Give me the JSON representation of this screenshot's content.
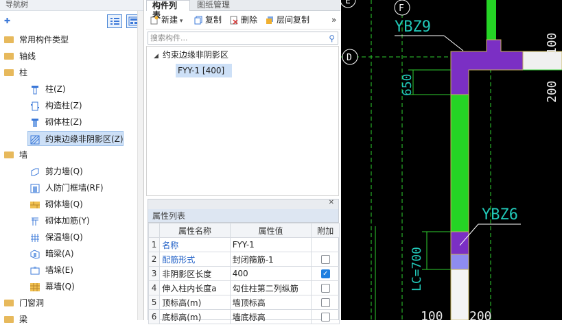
{
  "nav": {
    "title": "导航树",
    "items": [
      {
        "label": "常用构件类型"
      },
      {
        "label": "轴线"
      },
      {
        "label": "柱"
      },
      {
        "label": "柱(Z)"
      },
      {
        "label": "构造柱(Z)"
      },
      {
        "label": "砌体柱(Z)"
      },
      {
        "label": "约束边缘非阴影区(Z)"
      },
      {
        "label": "墙"
      },
      {
        "label": "剪力墙(Q)"
      },
      {
        "label": "人防门框墙(RF)"
      },
      {
        "label": "砌体墙(Q)"
      },
      {
        "label": "砌体加筋(Y)"
      },
      {
        "label": "保温墙(Q)"
      },
      {
        "label": "暗梁(A)"
      },
      {
        "label": "墙垛(E)"
      },
      {
        "label": "幕墙(Q)"
      },
      {
        "label": "门窗洞"
      },
      {
        "label": "梁"
      }
    ]
  },
  "tabs": [
    {
      "label": "构件列表"
    },
    {
      "label": "图纸管理"
    }
  ],
  "toolbar": {
    "new": "新建",
    "copy": "复制",
    "delete": "删除",
    "floor_copy": "层间复制",
    "more": "»"
  },
  "search": {
    "placeholder": "搜索构件..."
  },
  "component_tree": {
    "group": "约束边缘非阴影区",
    "item": "FYY-1 [400]"
  },
  "properties": {
    "title": "属性列表",
    "headers": [
      "属性名称",
      "属性值",
      "附加"
    ],
    "rows": [
      {
        "idx": "1",
        "name": "名称",
        "value": "FYY-1",
        "checked": null
      },
      {
        "idx": "2",
        "name": "配筋形式",
        "value": "封闭箍筋-1",
        "checked": false
      },
      {
        "idx": "3",
        "name": "非阴影区长度",
        "value": "400",
        "checked": true
      },
      {
        "idx": "4",
        "name": "伸入柱内长度a",
        "value": "勾住柱第二列纵筋",
        "checked": false
      },
      {
        "idx": "5",
        "name": "顶标高(m)",
        "value": "墙顶标高",
        "checked": false
      },
      {
        "idx": "6",
        "name": "底标高(m)",
        "value": "墙底标高",
        "checked": false
      }
    ]
  },
  "cad": {
    "axis_f": "F",
    "axis_d": "D",
    "axis_e": "E",
    "label_ybz9": "YBZ9",
    "label_ybz6": "YBZ6",
    "dim_650": "650",
    "dim_100_right": "100",
    "dim_200_right": "200",
    "dim_lc700": "LC=700",
    "dim_100_bottom": "100",
    "dim_200_bottom": "200",
    "colors": {
      "wall": "#25d425",
      "column": "#7b2fc4",
      "dim": "#21c7b7",
      "region": "#8e8cf0"
    }
  }
}
